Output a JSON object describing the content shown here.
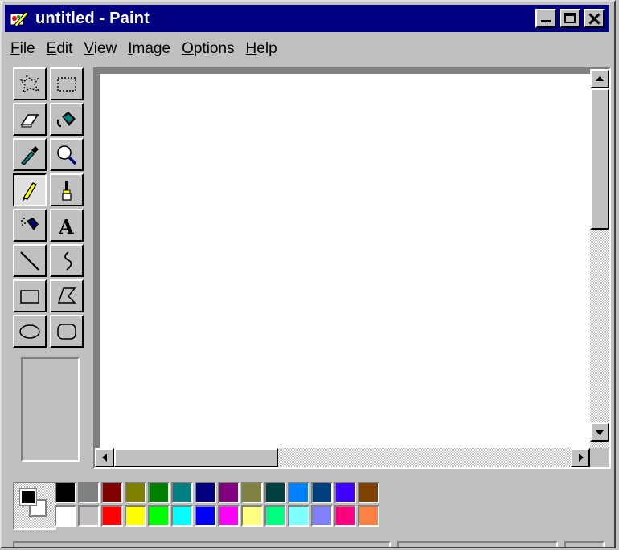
{
  "window": {
    "title": "untitled - Paint",
    "icon": "paint-palette-icon"
  },
  "menubar": {
    "items": [
      {
        "label_u": "F",
        "label_rest": "ile"
      },
      {
        "label_u": "E",
        "label_rest": "dit"
      },
      {
        "label_u": "V",
        "label_rest": "iew"
      },
      {
        "label_u": "I",
        "label_rest": "mage"
      },
      {
        "label_u": "O",
        "label_rest": "ptions"
      },
      {
        "label_u": "H",
        "label_rest": "elp"
      }
    ]
  },
  "toolbox": {
    "tools": [
      {
        "icon": "free-form-select-icon",
        "selected": false
      },
      {
        "icon": "rect-select-icon",
        "selected": false
      },
      {
        "icon": "eraser-icon",
        "selected": false
      },
      {
        "icon": "fill-bucket-icon",
        "selected": false
      },
      {
        "icon": "color-picker-icon",
        "selected": false
      },
      {
        "icon": "magnifier-icon",
        "selected": false
      },
      {
        "icon": "pencil-icon",
        "selected": true
      },
      {
        "icon": "brush-icon",
        "selected": false
      },
      {
        "icon": "airbrush-icon",
        "selected": false
      },
      {
        "icon": "text-icon",
        "selected": false,
        "glyph": "A"
      },
      {
        "icon": "line-icon",
        "selected": false
      },
      {
        "icon": "curve-icon",
        "selected": false
      },
      {
        "icon": "rectangle-icon",
        "selected": false
      },
      {
        "icon": "polygon-icon",
        "selected": false
      },
      {
        "icon": "ellipse-icon",
        "selected": false
      },
      {
        "icon": "rounded-rect-icon",
        "selected": false
      }
    ]
  },
  "colors": {
    "foreground": "#000000",
    "background": "#ffffff",
    "palette_row1": [
      "#000000",
      "#808080",
      "#800000",
      "#808000",
      "#008000",
      "#008080",
      "#000080",
      "#800080",
      "#808040",
      "#004040",
      "#0080ff",
      "#004080",
      "#4000ff",
      "#804000"
    ],
    "palette_row2": [
      "#ffffff",
      "#c0c0c0",
      "#ff0000",
      "#ffff00",
      "#00ff00",
      "#00ffff",
      "#0000ff",
      "#ff00ff",
      "#ffff80",
      "#00ff80",
      "#80ffff",
      "#8080ff",
      "#ff0080",
      "#ff8040"
    ]
  },
  "scrollbars": {
    "vertical_position": 0,
    "horizontal_position": 0
  }
}
